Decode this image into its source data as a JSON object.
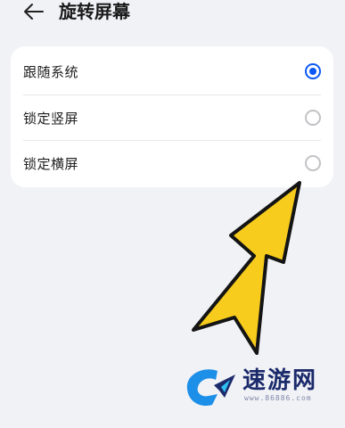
{
  "header": {
    "title": "旋转屏幕"
  },
  "options": [
    {
      "label": "跟随系统",
      "selected": true
    },
    {
      "label": "锁定竖屏",
      "selected": false
    },
    {
      "label": "锁定横屏",
      "selected": false
    }
  ],
  "watermark": {
    "brand": "速游网",
    "url": "www.86886.com"
  },
  "colors": {
    "accent": "#0a59f7",
    "pointer_arrow": "#f7cc1c",
    "background": "#f1f2f6"
  }
}
